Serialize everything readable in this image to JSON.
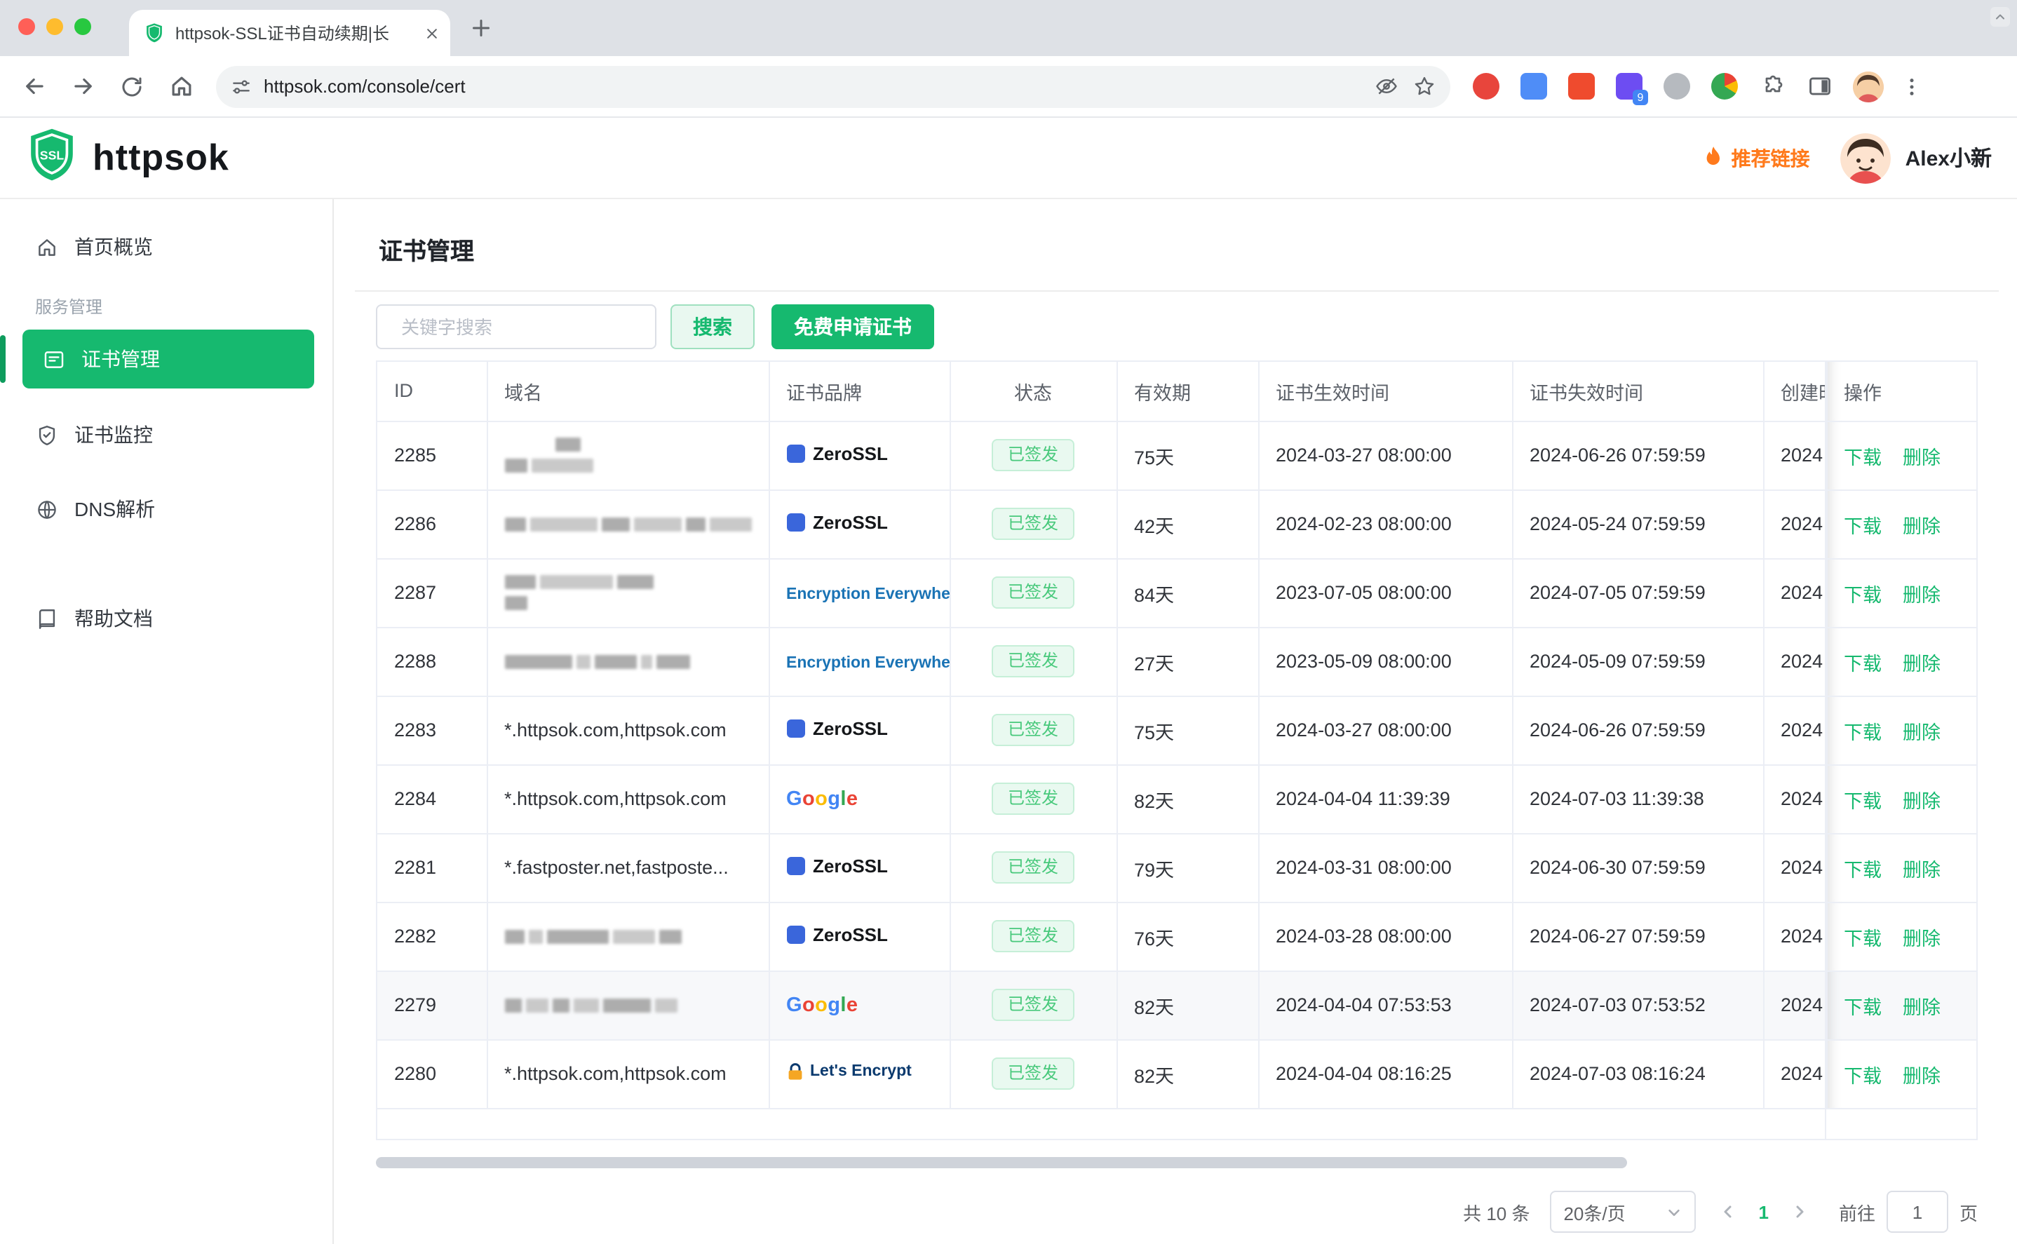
{
  "browser": {
    "tab_title": "httpsok-SSL证书自动续期|长",
    "url": "httpsok.com/console/cert",
    "extension_badge": "9"
  },
  "header": {
    "logo_text": "SSL",
    "brand": "httpsok",
    "referral": "推荐链接",
    "username": "Alex小新"
  },
  "sidebar": {
    "items": [
      {
        "label": "首页概览"
      },
      {
        "label": "服务管理"
      },
      {
        "label": "证书管理"
      },
      {
        "label": "证书监控"
      },
      {
        "label": "DNS解析"
      },
      {
        "label": "帮助文档"
      }
    ]
  },
  "google": [
    "G",
    "o",
    "o",
    "g",
    "l",
    "e"
  ],
  "main": {
    "title": "证书管理",
    "search": {
      "placeholder": "关键字搜索",
      "button": "搜索"
    },
    "apply_button": "免费申请证书",
    "table": {
      "columns": [
        "ID",
        "域名",
        "证书品牌",
        "状态",
        "有效期",
        "证书生效时间",
        "证书失效时间",
        "创建时间",
        "操作"
      ],
      "status_signed": "已签发",
      "op_download": "下载",
      "op_delete": "删除",
      "created_visible": "2024",
      "rows": [
        {
          "id": "2285",
          "domain": "",
          "brand": "ZeroSSL",
          "days": "75天",
          "valid_from": "2024-03-27 08:00:00",
          "valid_to": "2024-06-26 07:59:59"
        },
        {
          "id": "2286",
          "domain": "",
          "brand": "ZeroSSL",
          "days": "42天",
          "valid_from": "2024-02-23 08:00:00",
          "valid_to": "2024-05-24 07:59:59"
        },
        {
          "id": "2287",
          "domain": "",
          "brand": "Encryption Everywhere™",
          "days": "84天",
          "valid_from": "2023-07-05 08:00:00",
          "valid_to": "2024-07-05 07:59:59"
        },
        {
          "id": "2288",
          "domain": "",
          "brand": "Encryption Everywhere™",
          "days": "27天",
          "valid_from": "2023-05-09 08:00:00",
          "valid_to": "2024-05-09 07:59:59"
        },
        {
          "id": "2283",
          "domain": "*.httpsok.com,httpsok.com",
          "brand": "ZeroSSL",
          "days": "75天",
          "valid_from": "2024-03-27 08:00:00",
          "valid_to": "2024-06-26 07:59:59"
        },
        {
          "id": "2284",
          "domain": "*.httpsok.com,httpsok.com",
          "brand": "Google",
          "days": "82天",
          "valid_from": "2024-04-04 11:39:39",
          "valid_to": "2024-07-03 11:39:38"
        },
        {
          "id": "2281",
          "domain": "*.fastposter.net,fastposte...",
          "brand": "ZeroSSL",
          "days": "79天",
          "valid_from": "2024-03-31 08:00:00",
          "valid_to": "2024-06-30 07:59:59"
        },
        {
          "id": "2282",
          "domain": "",
          "brand": "ZeroSSL",
          "days": "76天",
          "valid_from": "2024-03-28 08:00:00",
          "valid_to": "2024-06-27 07:59:59"
        },
        {
          "id": "2279",
          "domain": "",
          "brand": "Google",
          "days": "82天",
          "valid_from": "2024-04-04 07:53:53",
          "valid_to": "2024-07-03 07:53:52"
        },
        {
          "id": "2280",
          "domain": "*.httpsok.com,httpsok.com",
          "brand": "Let's Encrypt",
          "days": "82天",
          "valid_from": "2024-04-04 08:16:25",
          "valid_to": "2024-07-03 08:16:24"
        }
      ]
    },
    "pagination": {
      "total": "共 10 条",
      "page_size": "20条/页",
      "page": "1",
      "goto_label": "前往",
      "goto_value": "1",
      "page_unit": "页"
    }
  }
}
